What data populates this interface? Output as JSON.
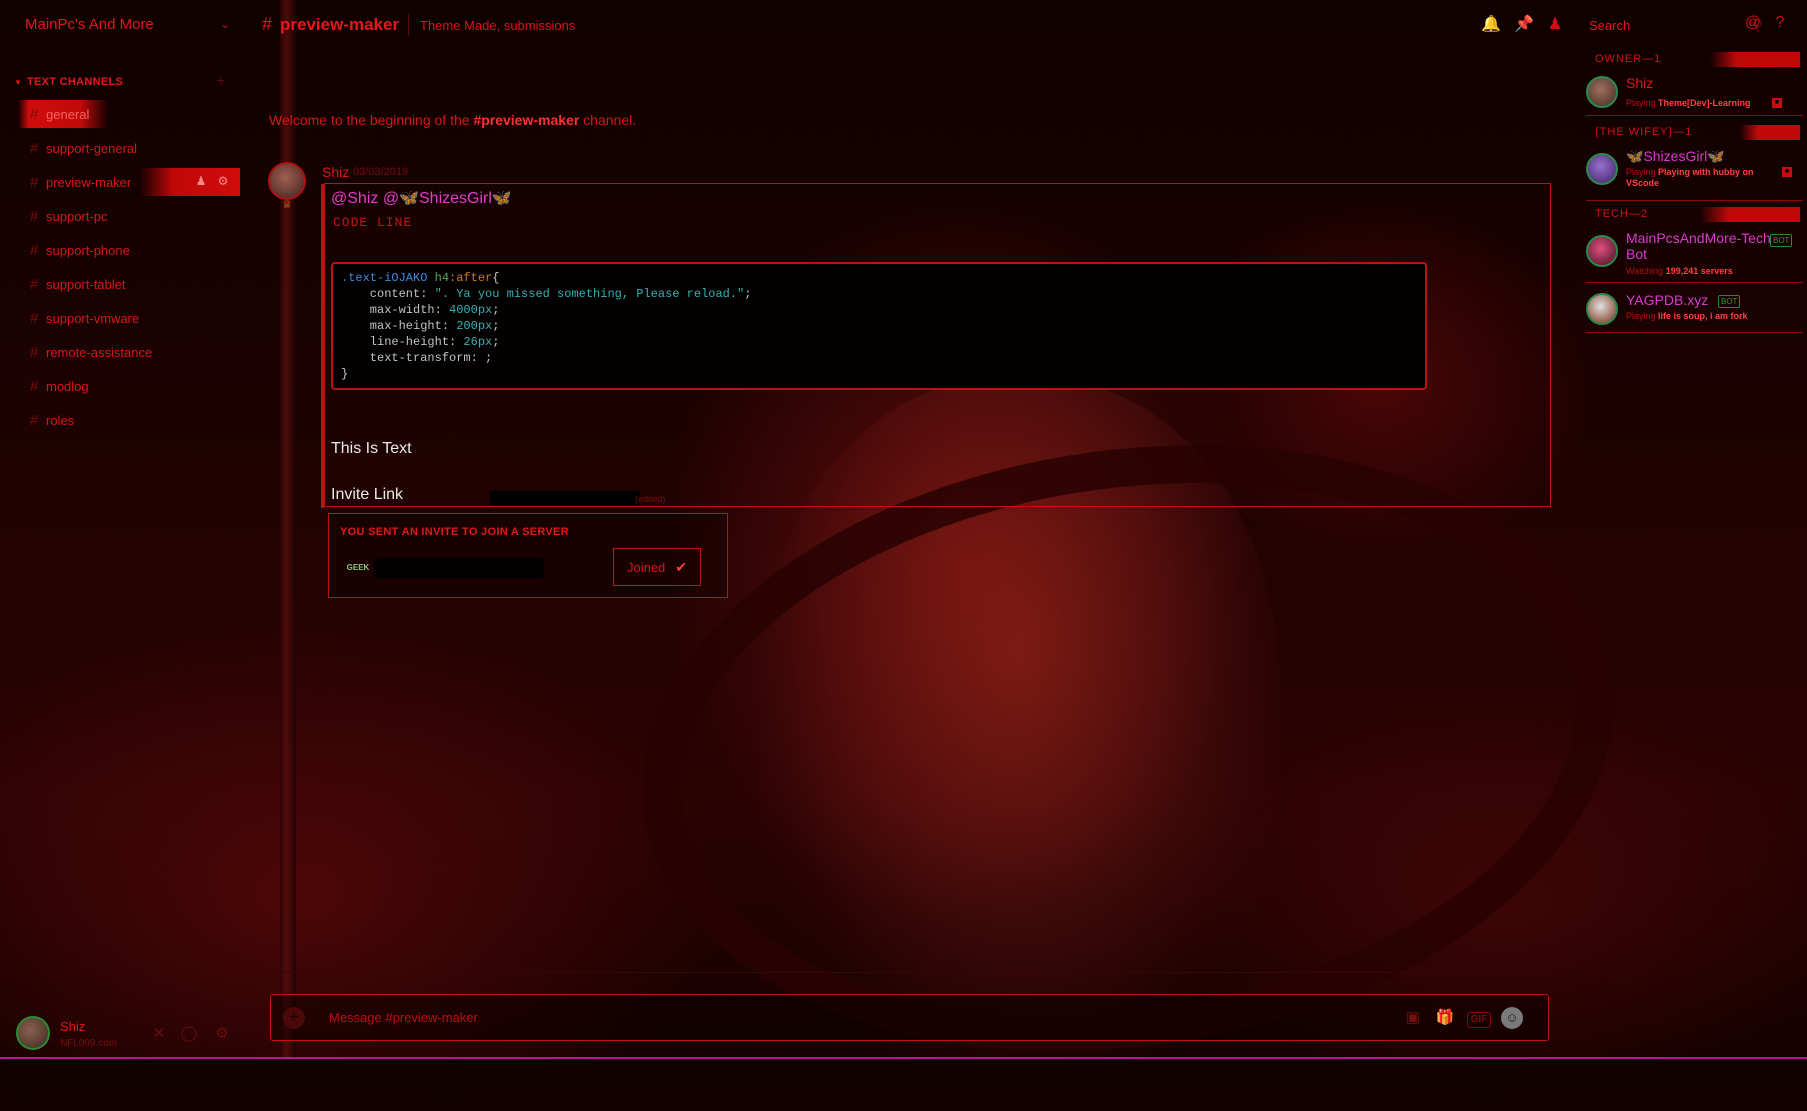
{
  "server": {
    "name": "MainPc's And More"
  },
  "sidebar": {
    "category": "TEXT CHANNELS",
    "channels": [
      {
        "name": "general"
      },
      {
        "name": "support-general"
      },
      {
        "name": "preview-maker"
      },
      {
        "name": "support-pc"
      },
      {
        "name": "support-phone"
      },
      {
        "name": "support-tablet"
      },
      {
        "name": "support-vmware"
      },
      {
        "name": "remote-assistance"
      },
      {
        "name": "modlog"
      },
      {
        "name": "roles"
      }
    ]
  },
  "user_panel": {
    "name": "Shiz",
    "tag": "NFL099.com"
  },
  "header": {
    "hash": "#",
    "channel": "preview-maker",
    "topic": "Theme Made, submissions",
    "search_placeholder": "Search"
  },
  "chat": {
    "welcome_prefix": "Welcome to the beginning of the ",
    "welcome_channel": "#preview-maker",
    "welcome_suffix": " channel.",
    "message": {
      "author": "Shiz",
      "timestamp": "03/03/2019",
      "mention1": "@Shiz",
      "mention2": "@🦋ShizesGirl🦋",
      "code_line": "CODE LINE",
      "code": {
        "selector": ".text-iOJAKO",
        "tag": " h4",
        "pseudo": ":after",
        "open": "{",
        "content_prop": "    content: ",
        "content_val": "\". Ya you missed something, Please reload.\"",
        "maxw_prop": "    max-width: ",
        "maxw_val": "4000px",
        "maxh_prop": "    max-height: ",
        "maxh_val": "200px",
        "lh_prop": "    line-height: ",
        "lh_val": "26px",
        "tt_prop": "    text-transform: ",
        "tt_val": ";",
        "close": "}"
      },
      "text": "This Is Text",
      "invite_label": "Invite Link",
      "edited": "(edited)"
    },
    "invite": {
      "heading": "YOU SENT AN INVITE TO JOIN A SERVER",
      "guild_icon_text": "GEEK",
      "button": "Joined"
    },
    "composer_placeholder": "Message #preview-maker"
  },
  "members": {
    "groups": [
      {
        "label": "OWNER—1",
        "members": [
          {
            "name": "Shiz",
            "activity_prefix": "Playing ",
            "activity": "Theme[Dev]-Learning",
            "bot": false
          }
        ]
      },
      {
        "label": "{THE WIFEY}—1",
        "members": [
          {
            "name": "🦋ShizesGirl🦋",
            "activity_prefix": "Playing ",
            "activity": "Playing with hubby on VScode",
            "bot": false
          }
        ]
      },
      {
        "label": "TECH—2",
        "members": [
          {
            "name": "MainPcsAndMore-Tech Bot",
            "activity_prefix": "Watching ",
            "activity": "199,241 servers",
            "bot": true
          },
          {
            "name": "YAGPDB.xyz",
            "activity_prefix": "Playing ",
            "activity": "life is soup, i am fork",
            "bot": true
          }
        ]
      }
    ],
    "bot_tag": "BOT"
  },
  "colors": {
    "accent": "#e01818",
    "background": "#1a0202",
    "mention": "#d83ad0",
    "online": "#2a8a4a"
  }
}
